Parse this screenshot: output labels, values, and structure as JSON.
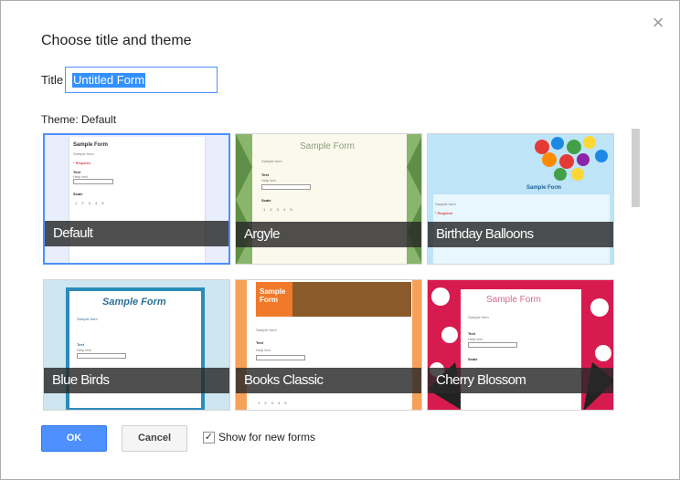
{
  "dialog": {
    "heading": "Choose title and theme",
    "close_glyph": "×",
    "title_label": "Title",
    "title_value": "Untitled Form",
    "theme_label": "Theme: Default"
  },
  "themes": [
    {
      "name": "Default",
      "selected": true,
      "preview_title": "Sample Form",
      "accent": "#4d90fe"
    },
    {
      "name": "Argyle",
      "selected": false,
      "preview_title": "Sample Form",
      "accent": "#6aa84f"
    },
    {
      "name": "Birthday Balloons",
      "selected": false,
      "preview_title": "Sample Form",
      "accent": "#1e7ebf"
    },
    {
      "name": "Blue Birds",
      "selected": false,
      "preview_title": "Sample Form",
      "accent": "#2b8cb8"
    },
    {
      "name": "Books Classic",
      "selected": false,
      "preview_title": "Sample Form",
      "accent": "#f6a15a"
    },
    {
      "name": "Cherry Blossom",
      "selected": false,
      "preview_title": "Sample Form",
      "accent": "#e2255f"
    }
  ],
  "preview": {
    "sample_text": "Sample form",
    "required": "* Required",
    "text_label": "Text",
    "help_text": "Help text",
    "scale_label": "Scale",
    "scale_dots": "1 2 3 4 5"
  },
  "footer": {
    "ok_label": "OK",
    "cancel_label": "Cancel",
    "show_checkbox_label": "Show for new forms",
    "checkbox_checked": true,
    "check_glyph": "✓"
  }
}
